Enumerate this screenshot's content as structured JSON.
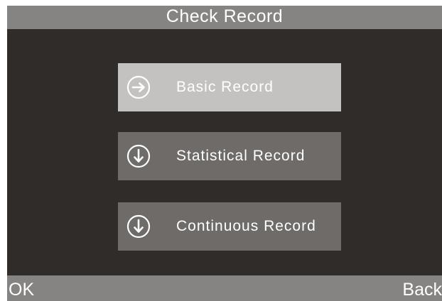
{
  "header": {
    "title": "Check Record"
  },
  "menu": {
    "items": [
      {
        "label": "Basic Record",
        "icon": "arrow-right-circle-icon",
        "selected": true
      },
      {
        "label": "Statistical Record",
        "icon": "arrow-down-circle-icon",
        "selected": false
      },
      {
        "label": "Continuous Record",
        "icon": "arrow-down-circle-icon",
        "selected": false
      }
    ]
  },
  "softkeys": {
    "left": "OK",
    "right": "Back"
  },
  "colors": {
    "background": "#302c2a",
    "bar": "#868482",
    "item": "#6e6b69",
    "item_selected": "#c4c2c0",
    "text": "#ffffff"
  }
}
